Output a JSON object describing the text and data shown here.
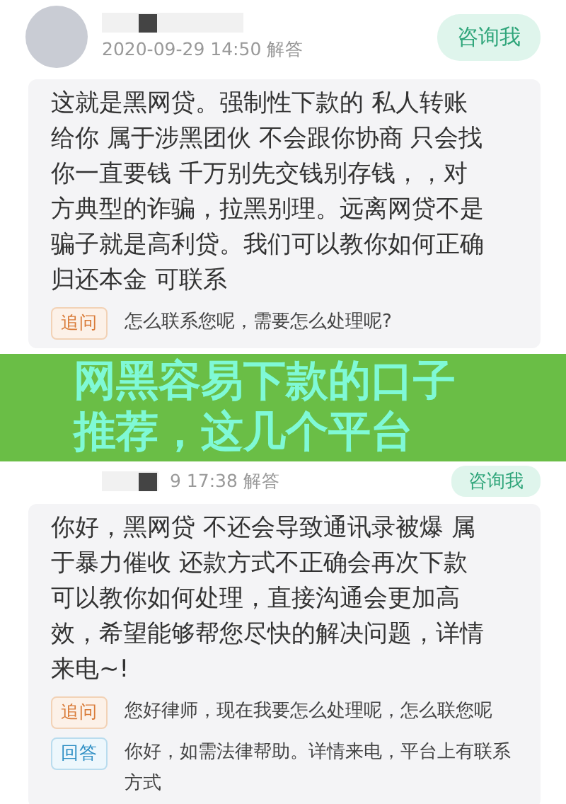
{
  "answers": [
    {
      "kind": "full",
      "date": "2020-09-29 14:50 解答",
      "consult_button": "咨询我",
      "body": "这就是黑网贷。强制性下款的 私人转账给你 属于涉黑团伙 不会跟你协商 只会找你一直要钱 千万别先交钱别存钱，，对方典型的诈骗，拉黑别理。远离网贷不是骗子就是高利贷。我们可以教你如何正确归还本金 可联系",
      "followups": [
        {
          "kind": "ask",
          "tag": "追问",
          "text": "怎么联系您呢，需要怎么处理呢?"
        }
      ]
    },
    {
      "kind": "partial",
      "date": "9 17:38 解答",
      "consult_button": "咨询我",
      "body": "你好，黑网贷 不还会导致通讯录被爆 属于暴力催收 还款方式不正确会再次下款可以教你如何处理，直接沟通会更加高效，希望能够帮您尽快的解决问题，详情来电~!",
      "followups": [
        {
          "kind": "ask",
          "tag": "追问",
          "text": "您好律师，现在我要怎么处理呢，怎么联您呢"
        },
        {
          "kind": "answer",
          "tag": "回答",
          "text": "你好，如需法律帮助。详情来电，平台上有联系方式"
        }
      ]
    }
  ],
  "banner": {
    "title": "网黑容易下款的口子推荐，这几个平台"
  }
}
